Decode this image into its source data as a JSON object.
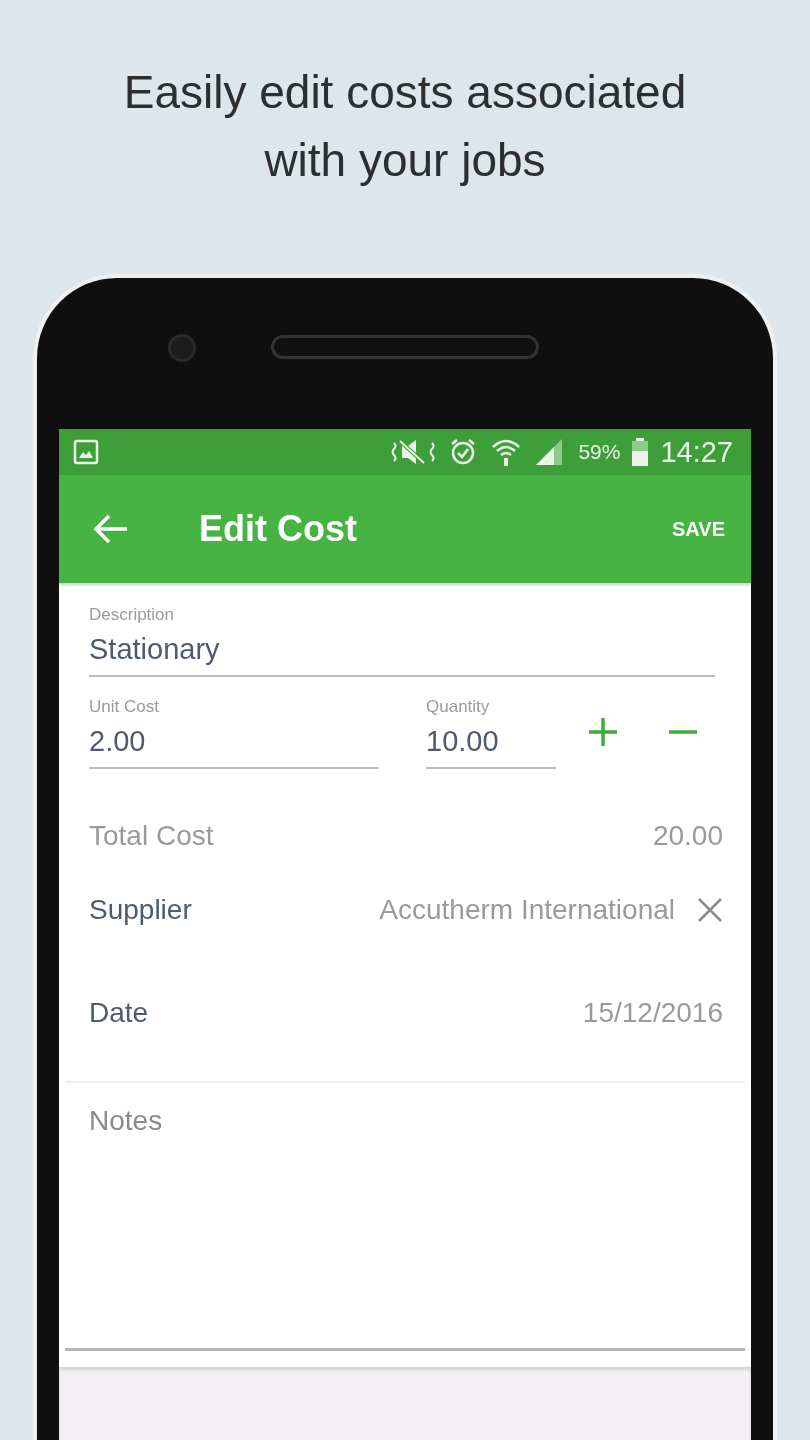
{
  "headline": "Easily edit costs associated with your jobs",
  "status_bar": {
    "battery": "59%",
    "time": "14:27"
  },
  "app_bar": {
    "title": "Edit Cost",
    "action": "SAVE"
  },
  "description": {
    "label": "Description",
    "value": "Stationary"
  },
  "unit_cost": {
    "label": "Unit Cost",
    "value": "2.00"
  },
  "quantity": {
    "label": "Quantity",
    "value": "10.00"
  },
  "total": {
    "label": "Total Cost",
    "value": "20.00"
  },
  "rows": [
    {
      "label": "Supplier",
      "value": "Accutherm International",
      "clearable": true
    },
    {
      "label": "Date",
      "value": "15/12/2016",
      "clearable": false
    }
  ],
  "notes": {
    "placeholder": "Notes"
  }
}
